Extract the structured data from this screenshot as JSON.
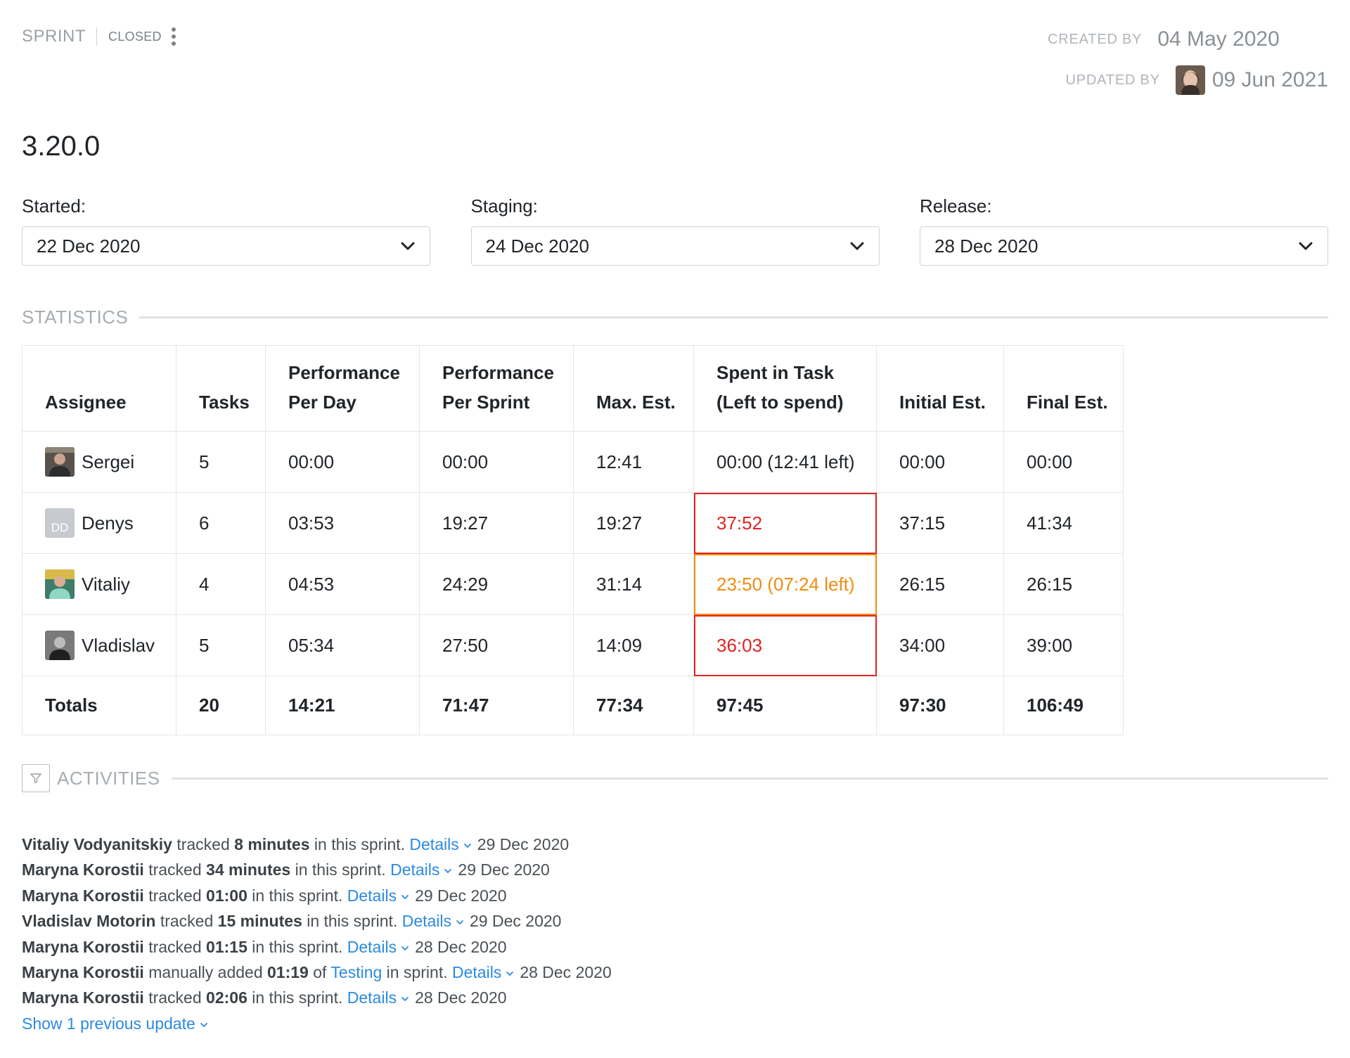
{
  "header": {
    "type_label": "SPRINT",
    "status_label": "CLOSED",
    "created_by_label": "CREATED BY",
    "created_date": "04 May 2020",
    "updated_by_label": "UPDATED BY",
    "updated_date": "09 Jun 2021"
  },
  "sprint": {
    "name": "3.20.0"
  },
  "dates": {
    "started": {
      "label": "Started:",
      "value": "22 Dec 2020"
    },
    "staging": {
      "label": "Staging:",
      "value": "24 Dec 2020"
    },
    "release": {
      "label": "Release:",
      "value": "28 Dec 2020"
    }
  },
  "statistics": {
    "title": "STATISTICS",
    "columns": [
      {
        "line1": "Assignee",
        "line2": ""
      },
      {
        "line1": "Tasks",
        "line2": ""
      },
      {
        "line1": "Performance",
        "line2": "Per Day"
      },
      {
        "line1": "Performance",
        "line2": "Per Sprint"
      },
      {
        "line1": "Max. Est.",
        "line2": ""
      },
      {
        "line1": "Spent in Task",
        "line2": "(Left to spend)"
      },
      {
        "line1": "Initial Est.",
        "line2": ""
      },
      {
        "line1": "Final Est.",
        "line2": ""
      }
    ],
    "rows": [
      {
        "name": "Sergei",
        "initials": "",
        "tasks": "5",
        "per_day": "00:00",
        "per_sprint": "00:00",
        "max_est": "12:41",
        "spent": "00:00 (12:41 left)",
        "spent_status": "normal",
        "initial_est": "00:00",
        "final_est": "00:00"
      },
      {
        "name": "Denys",
        "initials": "DD",
        "tasks": "6",
        "per_day": "03:53",
        "per_sprint": "19:27",
        "max_est": "19:27",
        "spent": "37:52",
        "spent_status": "over",
        "initial_est": "37:15",
        "final_est": "41:34"
      },
      {
        "name": "Vitaliy",
        "initials": "",
        "tasks": "4",
        "per_day": "04:53",
        "per_sprint": "24:29",
        "max_est": "31:14",
        "spent": "23:50 (07:24 left)",
        "spent_status": "warning",
        "initial_est": "26:15",
        "final_est": "26:15"
      },
      {
        "name": "Vladislav",
        "initials": "",
        "tasks": "5",
        "per_day": "05:34",
        "per_sprint": "27:50",
        "max_est": "14:09",
        "spent": "36:03",
        "spent_status": "over",
        "initial_est": "34:00",
        "final_est": "39:00"
      }
    ],
    "totals": {
      "label": "Totals",
      "tasks": "20",
      "per_day": "14:21",
      "per_sprint": "71:47",
      "max_est": "77:34",
      "spent": "97:45",
      "initial_est": "97:30",
      "final_est": "106:49"
    }
  },
  "activities": {
    "title": "ACTIVITIES",
    "details_label": "Details",
    "items": [
      {
        "user": "Vitaliy Vodyanitskiy",
        "verb": "tracked",
        "amount": "8 minutes",
        "suffix": "in this sprint.",
        "date": "29 Dec 2020"
      },
      {
        "user": "Maryna Korostii",
        "verb": "tracked",
        "amount": "34 minutes",
        "suffix": "in this sprint.",
        "date": "29 Dec 2020"
      },
      {
        "user": "Maryna Korostii",
        "verb": "tracked",
        "amount": "01:00",
        "suffix": "in this sprint.",
        "date": "29 Dec 2020"
      },
      {
        "user": "Vladislav Motorin",
        "verb": "tracked",
        "amount": "15 minutes",
        "suffix": "in this sprint.",
        "date": "29 Dec 2020"
      },
      {
        "user": "Maryna Korostii",
        "verb": "tracked",
        "amount": "01:15",
        "suffix": "in this sprint.",
        "date": "28 Dec 2020"
      },
      {
        "user": "Maryna Korostii",
        "verb": "manually added",
        "amount": "01:19",
        "of_word": "of",
        "task_link": "Testing",
        "suffix": "in sprint.",
        "date": "28 Dec 2020"
      },
      {
        "user": "Maryna Korostii",
        "verb": "tracked",
        "amount": "02:06",
        "suffix": "in this sprint.",
        "date": "28 Dec 2020"
      }
    ],
    "show_more": "Show 1 previous update"
  },
  "colors": {
    "link": "#2b8ae0",
    "over": "#e02424",
    "warning": "#f28c0f",
    "muted": "#a7adb3"
  }
}
